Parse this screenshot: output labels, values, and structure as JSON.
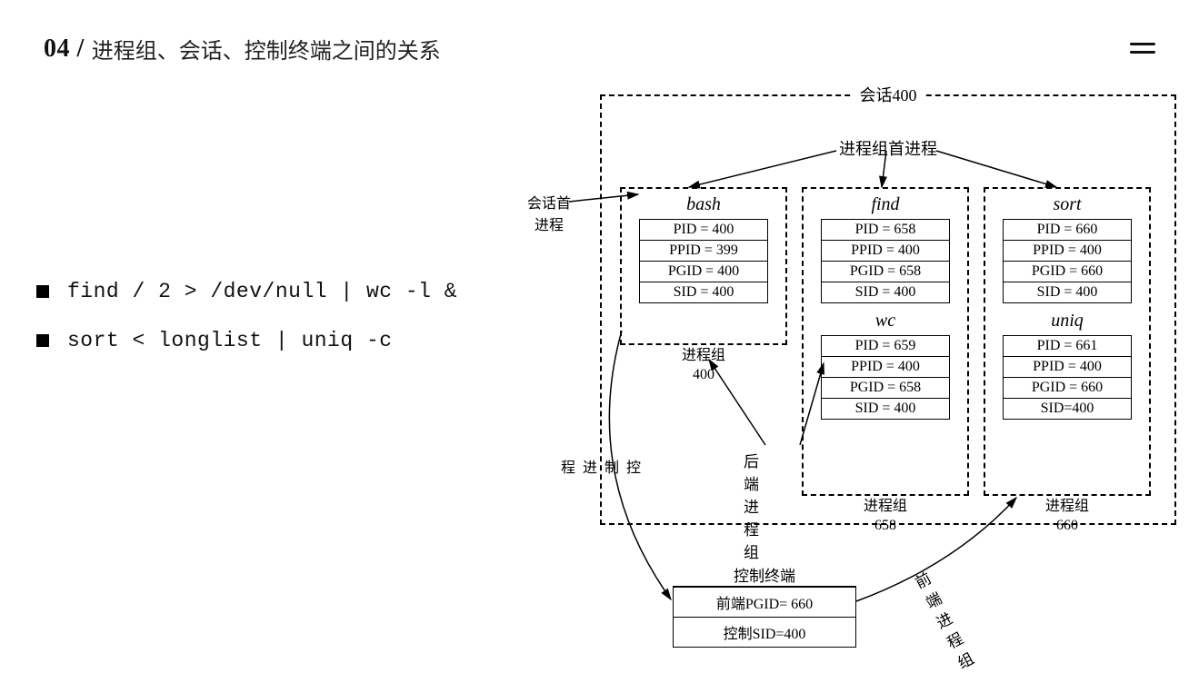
{
  "header": {
    "chapter_num": "04 /",
    "title": "进程组、会话、控制终端之间的关系"
  },
  "commands": [
    "find / 2 > /dev/null | wc -l &",
    "sort < longlist | uniq -c"
  ],
  "diagram": {
    "session_label": "会话400",
    "leader_label": "进程组首进程",
    "sess_leader_side": "会话首\n进程",
    "ctrl_proc_side": "控制进程",
    "back_group_label": "后端进程组",
    "front_group_label": "前端进程组",
    "groups": [
      {
        "caption": "进程组\n400",
        "processes": [
          {
            "name": "bash",
            "pid": "PID = 400",
            "ppid": "PPID = 399",
            "pgid": "PGID = 400",
            "sid": "SID = 400"
          }
        ]
      },
      {
        "caption": "进程组\n658",
        "processes": [
          {
            "name": "find",
            "pid": "PID = 658",
            "ppid": "PPID = 400",
            "pgid": "PGID = 658",
            "sid": "SID = 400"
          },
          {
            "name": "wc",
            "pid": "PID = 659",
            "ppid": "PPID = 400",
            "pgid": "PGID = 658",
            "sid": "SID = 400"
          }
        ]
      },
      {
        "caption": "进程组\n660",
        "processes": [
          {
            "name": "sort",
            "pid": "PID = 660",
            "ppid": "PPID = 400",
            "pgid": "PGID = 660",
            "sid": "SID = 400"
          },
          {
            "name": "uniq",
            "pid": "PID = 661",
            "ppid": "PPID = 400",
            "pgid": "PGID = 660",
            "sid": "SID=400"
          }
        ]
      }
    ],
    "terminal": {
      "title": "控制终端",
      "row1": "前端PGID=  660",
      "row2": "控制SID=400"
    }
  }
}
